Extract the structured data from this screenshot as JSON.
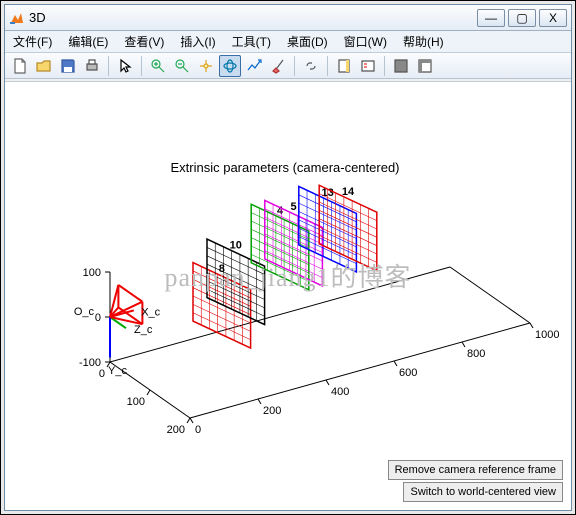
{
  "window": {
    "title": "3D",
    "buttons": {
      "min": "—",
      "max": "▢",
      "close": "X"
    }
  },
  "menu": [
    "文件(F)",
    "编辑(E)",
    "查看(V)",
    "插入(I)",
    "工具(T)",
    "桌面(D)",
    "窗口(W)",
    "帮助(H)"
  ],
  "toolbar_icons": [
    "new-file-icon",
    "open-file-icon",
    "save-icon",
    "print-icon",
    "sep",
    "pointer-icon",
    "sep",
    "zoom-in-icon",
    "zoom-out-icon",
    "pan-icon",
    "rotate-3d-icon",
    "data-cursor-icon",
    "brush-icon",
    "sep",
    "link-icon",
    "sep",
    "insert-colorbar-icon",
    "insert-legend-icon",
    "sep",
    "hide-plot-tools-icon",
    "show-plot-tools-icon"
  ],
  "plot": {
    "title": "Extrinsic parameters (camera-centered)",
    "camera_origin_label": "O_c",
    "axis_labels": {
      "x": "X_c",
      "y": "Y_c",
      "z": "Z_c"
    },
    "ticks": {
      "x_depth": [
        0,
        200,
        400,
        600,
        800,
        1000
      ],
      "y_horiz": [
        0,
        100,
        200
      ],
      "z_vert": [
        -100,
        0,
        100
      ]
    },
    "boards": [
      {
        "id": 8,
        "pos": [
          250,
          50,
          0
        ],
        "color": "#e00000"
      },
      {
        "id": 10,
        "pos": [
          350,
          0,
          0
        ],
        "color": "#000000"
      },
      {
        "id": 4,
        "pos": [
          480,
          0,
          50
        ],
        "color": "#00a000"
      },
      {
        "id": 5,
        "pos": [
          520,
          0,
          50
        ],
        "color": "#e000e0"
      },
      {
        "id": 13,
        "pos": [
          620,
          0,
          60
        ],
        "color": "#0000ff"
      },
      {
        "id": 14,
        "pos": [
          680,
          0,
          50
        ],
        "color": "#e00000"
      }
    ]
  },
  "watermark": "panpan_jiang1的博客",
  "buttons": {
    "remove_frame": "Remove camera reference frame",
    "switch_view": "Switch to world-centered view"
  },
  "chart_data": {
    "type": "scatter",
    "title": "Extrinsic parameters (camera-centered)",
    "xlabel": "X_c",
    "ylabel": "Y_c",
    "zlabel": "Z_c",
    "z_axis_depth_range": [
      0,
      1000
    ],
    "y_axis_horiz_range": [
      0,
      200
    ],
    "x_axis_vert_range": [
      -100,
      100
    ],
    "z_ticks": [
      0,
      200,
      400,
      600,
      800,
      1000
    ],
    "y_ticks": [
      0,
      100,
      200
    ],
    "x_ticks": [
      -100,
      0,
      100
    ],
    "series": [
      {
        "name": "8",
        "color": "red",
        "approx_center": [
          250,
          50,
          0
        ]
      },
      {
        "name": "10",
        "color": "black",
        "approx_center": [
          350,
          0,
          0
        ]
      },
      {
        "name": "4",
        "color": "green",
        "approx_center": [
          480,
          0,
          50
        ]
      },
      {
        "name": "5",
        "color": "magenta",
        "approx_center": [
          520,
          0,
          50
        ]
      },
      {
        "name": "13",
        "color": "blue",
        "approx_center": [
          620,
          0,
          60
        ]
      },
      {
        "name": "14",
        "color": "red",
        "approx_center": [
          680,
          0,
          50
        ]
      }
    ],
    "camera_frame_origin": [
      0,
      0,
      0
    ]
  }
}
